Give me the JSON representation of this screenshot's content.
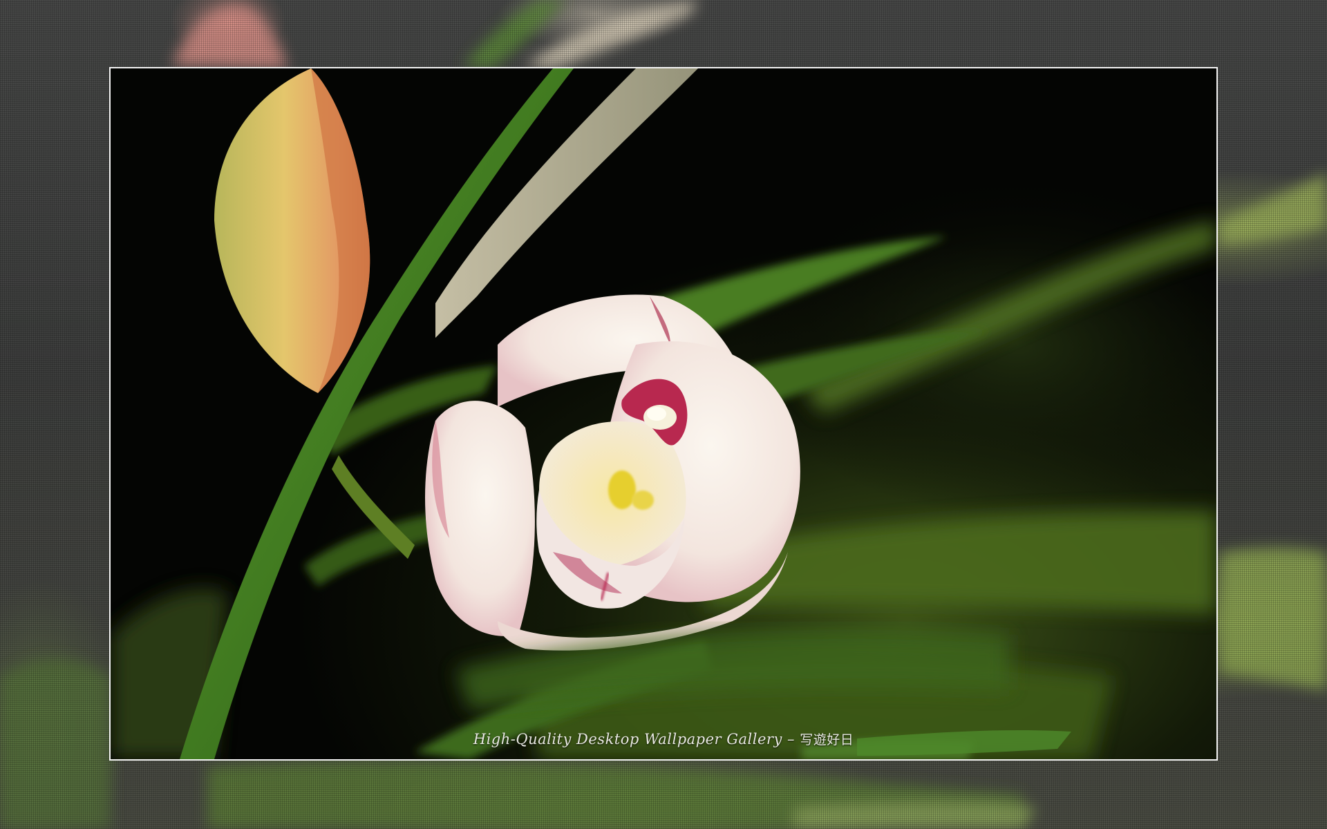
{
  "caption": {
    "title": "High-Quality Desktop Wallpaper Gallery",
    "separator": "–",
    "site_name": "写遊好日"
  },
  "colors": {
    "frame_border": "#f4f4f4",
    "outer_background": "#3d3e3d",
    "photo_background": "#040503",
    "petal": "#f6efe9",
    "petal_blush": "#e4a9b3",
    "lip_spot": "#b8284f",
    "leaf": "#3f7a22",
    "bud": "#d9b45a"
  }
}
